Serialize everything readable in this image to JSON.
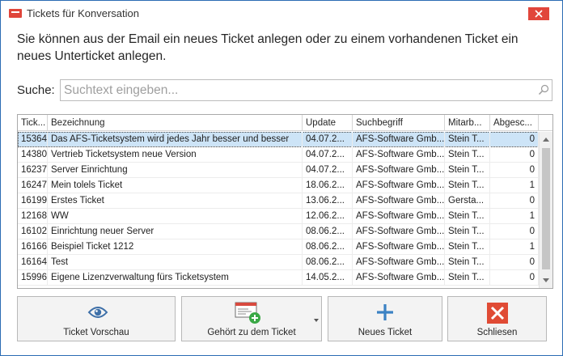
{
  "window": {
    "title": "Tickets für Konversation",
    "icon": "app-icon",
    "close": "close-icon"
  },
  "intro_text": "Sie können aus der Email ein neues Ticket anlegen oder zu einem vorhandenen Ticket ein neues Unterticket anlegen.",
  "search": {
    "label": "Suche:",
    "placeholder": "Suchtext eingeben...",
    "value": "",
    "icon": "search-icon"
  },
  "grid": {
    "columns": [
      "Tick...",
      "Bezeichnung",
      "Update",
      "Suchbegriff",
      "Mitarb...",
      "Abgesc..."
    ],
    "rows": [
      [
        "15364",
        "Das AFS-Ticketsystem wird jedes Jahr besser und besser",
        "04.07.2...",
        "AFS-Software Gmb...",
        "Stein T...",
        "0"
      ],
      [
        "14380",
        "Vertrieb Ticketsystem neue Version",
        "04.07.2...",
        "AFS-Software Gmb...",
        "Stein T...",
        "0"
      ],
      [
        "16237",
        "Server Einrichtung",
        "04.07.2...",
        "AFS-Software Gmb...",
        "Stein T...",
        "0"
      ],
      [
        "16247",
        "Mein tolels Ticket",
        "18.06.2...",
        "AFS-Software Gmb...",
        "Stein T...",
        "1"
      ],
      [
        "16199",
        "Erstes Ticket",
        "13.06.2...",
        "AFS-Software Gmb...",
        "Gersta...",
        "0"
      ],
      [
        "12168",
        "WW",
        "12.06.2...",
        "AFS-Software Gmb...",
        "Stein T...",
        "1"
      ],
      [
        "16102",
        "Einrichtung neuer Server",
        "08.06.2...",
        "AFS-Software Gmb...",
        "Stein T...",
        "0"
      ],
      [
        "16166",
        "Beispiel Ticket 1212",
        "08.06.2...",
        "AFS-Software Gmb...",
        "Stein T...",
        "1"
      ],
      [
        "16164",
        "Test",
        "08.06.2...",
        "AFS-Software Gmb...",
        "Stein T...",
        "0"
      ],
      [
        "15996",
        "Eigene Lizenzverwaltung fürs Ticketsystem",
        "14.05.2...",
        "AFS-Software Gmb...",
        "Stein T...",
        "0"
      ]
    ],
    "selected_row": 0
  },
  "buttons": {
    "preview": {
      "label": "Ticket Vorschau",
      "icon": "eye-icon"
    },
    "belongs": {
      "label": "Gehört zu dem Ticket",
      "icon": "ticket-add-icon",
      "dropdown_icon": "chevron-down-icon"
    },
    "new_ticket": {
      "label": "Neues Ticket",
      "icon": "plus-icon"
    },
    "close": {
      "label": "Schliesen",
      "icon": "close-x-icon"
    }
  },
  "colors": {
    "accent": "#2b6cb3",
    "selection": "#cde4f7",
    "close_red": "#e1463b",
    "add_green": "#39a845",
    "plus_blue": "#3b82c4"
  }
}
